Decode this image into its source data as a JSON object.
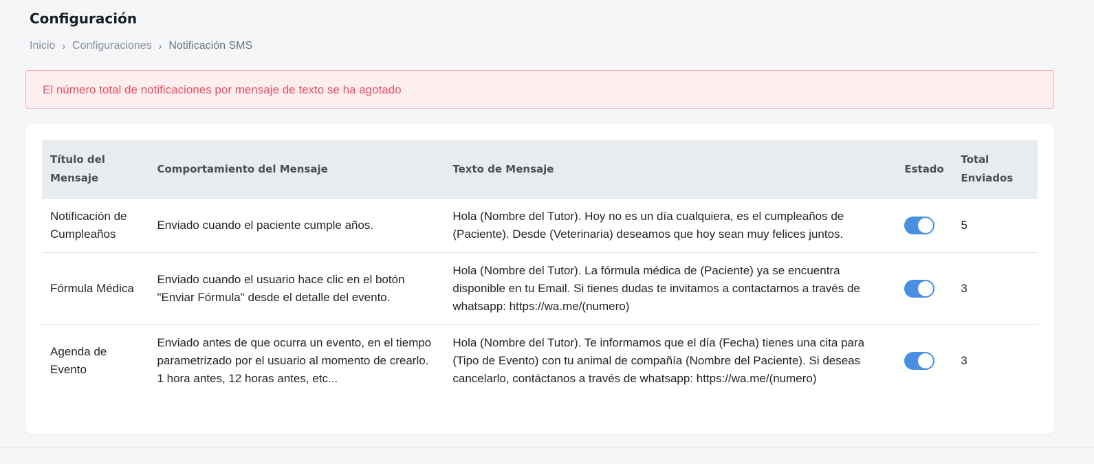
{
  "page": {
    "title": "Configuración"
  },
  "breadcrumb": {
    "items": [
      "Inicio",
      "Configuraciones"
    ],
    "current": "Notificación SMS"
  },
  "alert": {
    "text": "El número total de notificaciones por mensaje de texto se ha agotado"
  },
  "table": {
    "headers": {
      "title": "Título del Mensaje",
      "behavior": "Comportamiento del Mensaje",
      "text": "Texto de Mensaje",
      "state": "Estado",
      "total": "Total Enviados"
    },
    "rows": [
      {
        "title": "Notificación de Cumpleaños",
        "behavior": "Enviado cuando el paciente cumple años.",
        "text": "Hola (Nombre del Tutor). Hoy no es un día cualquiera, es el cumpleaños de (Paciente). Desde (Veterinaria) deseamos que hoy sean muy felices juntos.",
        "enabled": true,
        "total": "5"
      },
      {
        "title": "Fórmula Médica",
        "behavior": "Enviado cuando el usuario hace clic en el botón \"Enviar Fórmula\" desde el detalle del evento.",
        "text": "Hola (Nombre del Tutor). La fórmula médica de (Paciente) ya se encuentra disponible en tu Email. Si tienes dudas te invitamos a contactarnos a través de whatsapp: https://wa.me/(numero)",
        "enabled": true,
        "total": "3"
      },
      {
        "title": "Agenda de Evento",
        "behavior": "Enviado antes de que ocurra un evento, en el tiempo parametrizado por el usuario al momento de crearlo. 1 hora antes, 12 horas antes, etc...",
        "text": "Hola (Nombre del Tutor). Te informamos que el día (Fecha) tienes una cita para (Tipo de Evento) con tu animal de compañía (Nombre del Paciente). Si deseas cancelarlo, contáctanos a través de whatsapp: https://wa.me/(numero)",
        "enabled": true,
        "total": "3"
      }
    ]
  },
  "colors": {
    "toggle_on": "#4a90e2",
    "alert_text": "#e55364",
    "alert_bg": "#fdeef0"
  }
}
